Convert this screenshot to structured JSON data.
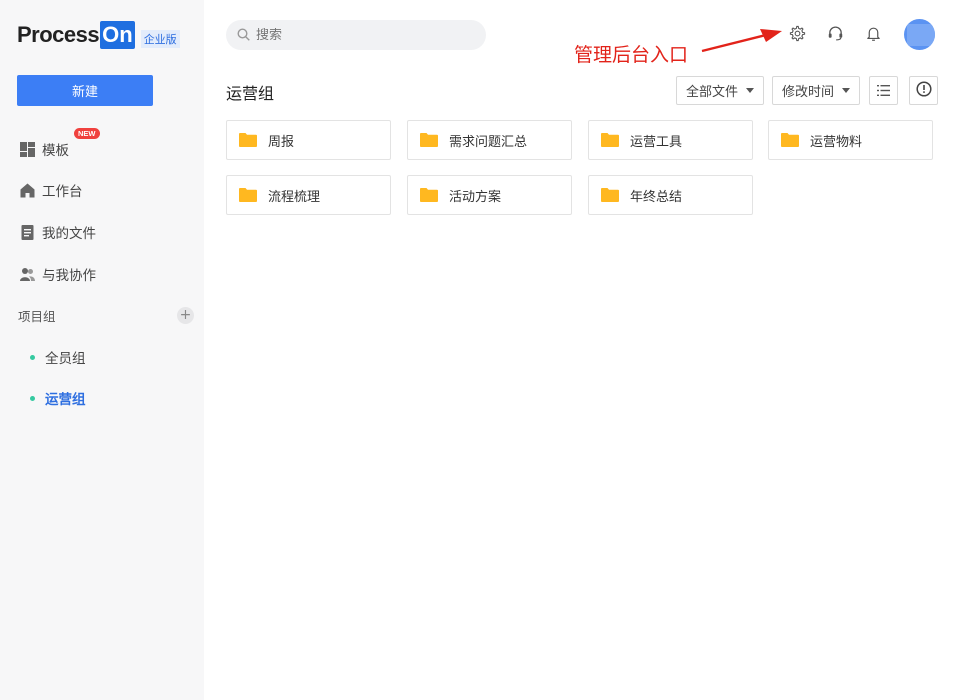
{
  "logo": {
    "process": "Process",
    "on": "On",
    "badge": "企业版"
  },
  "sidebar": {
    "new_button": "新建",
    "nav": [
      {
        "label": "模板",
        "icon": "template-grid-icon",
        "badge": "NEW"
      },
      {
        "label": "工作台",
        "icon": "home-icon"
      },
      {
        "label": "我的文件",
        "icon": "document-icon"
      },
      {
        "label": "与我协作",
        "icon": "people-icon"
      }
    ],
    "group_header": "项目组",
    "group_add": "+",
    "groups": [
      {
        "label": "全员组",
        "active": false
      },
      {
        "label": "运营组",
        "active": true
      }
    ]
  },
  "header": {
    "search_placeholder": "搜索",
    "icons": [
      "settings-gear-icon",
      "headset-support-icon",
      "bell-icon"
    ],
    "annotation": "管理后台入口"
  },
  "main": {
    "title": "运营组",
    "filter_label": "全部文件",
    "sort_label": "修改时间",
    "folders": [
      "周报",
      "需求问题汇总",
      "运营工具",
      "运营物料",
      "流程梳理",
      "活动方案",
      "年终总结"
    ]
  },
  "colors": {
    "accent": "#3c7ef5",
    "folder": "#ffb820",
    "annotation": "#e2231a",
    "group_dot": "#35c9a0"
  }
}
